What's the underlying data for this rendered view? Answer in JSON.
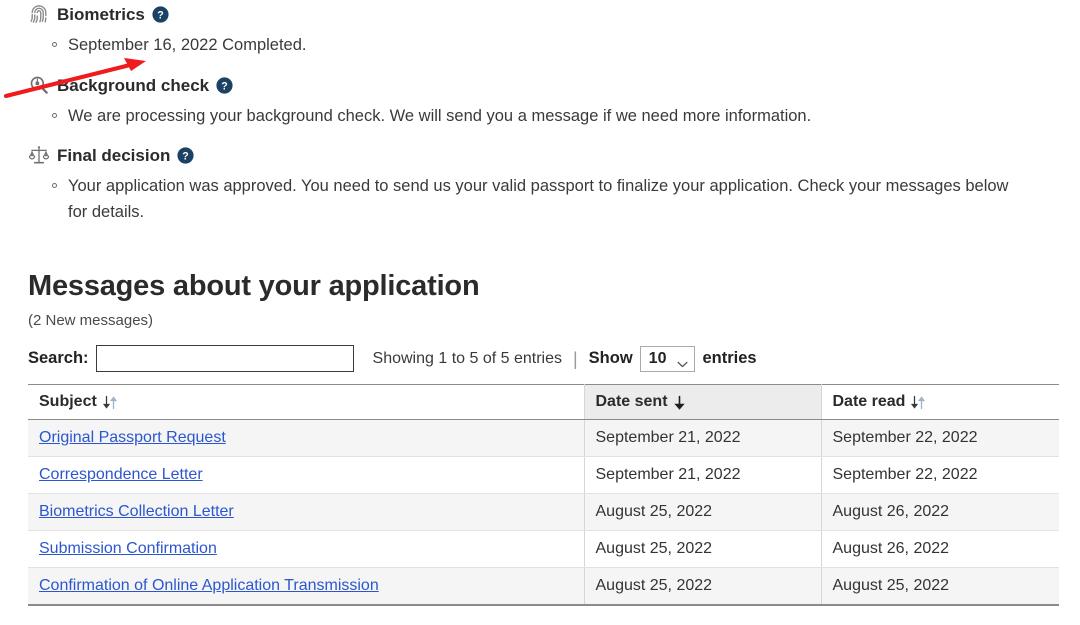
{
  "status": {
    "stages": [
      {
        "icon": "fingerprint-icon",
        "title": "Biometrics",
        "help_label": "?",
        "items": [
          "September 16, 2022 Completed."
        ]
      },
      {
        "icon": "magnifier-icon",
        "title": "Background check",
        "help_label": "?",
        "items": [
          "We are processing your background check. We will send you a message if we need more information."
        ]
      },
      {
        "icon": "scales-icon",
        "title": "Final decision",
        "help_label": "?",
        "items": [
          "Your application was approved. You need to send us your valid passport to finalize your application. Check your messages below for details."
        ]
      }
    ]
  },
  "messages": {
    "title": "Messages about your application",
    "new_count_text": "(2 New messages)",
    "controls": {
      "search_label": "Search:",
      "search_value": "",
      "search_placeholder": "",
      "showing_text": "Showing 1 to 5 of 5 entries",
      "divider": "|",
      "show_label": "Show",
      "page_length": "10",
      "entries_label": "entries"
    },
    "table": {
      "columns": [
        {
          "label": "Subject",
          "sort_state": "sortable"
        },
        {
          "label": "Date sent",
          "sort_state": "desc"
        },
        {
          "label": "Date read",
          "sort_state": "sortable"
        }
      ],
      "rows": [
        {
          "subject": "Original Passport Request",
          "date_sent": "September 21, 2022",
          "date_read": "September 22, 2022"
        },
        {
          "subject": "Correspondence Letter",
          "date_sent": "September 21, 2022",
          "date_read": "September 22, 2022"
        },
        {
          "subject": "Biometrics Collection Letter",
          "date_sent": "August 25, 2022",
          "date_read": "August 26, 2022"
        },
        {
          "subject": "Submission Confirmation",
          "date_sent": "August 25, 2022",
          "date_read": "August 26, 2022"
        },
        {
          "subject": "Confirmation of Online Application Transmission",
          "date_sent": "August 25, 2022",
          "date_read": "August 25, 2022"
        }
      ]
    }
  },
  "annotation": {
    "type": "arrow",
    "color": "#ee1c1c",
    "points_to": "Background check"
  },
  "colors": {
    "link": "#2c56cf",
    "help_icon": "#1b4264",
    "heading": "#2b2b2b",
    "sorted_header_bg": "#ececec",
    "row_odd_bg": "#f5f5f5",
    "annotation": "#ee1c1c"
  }
}
